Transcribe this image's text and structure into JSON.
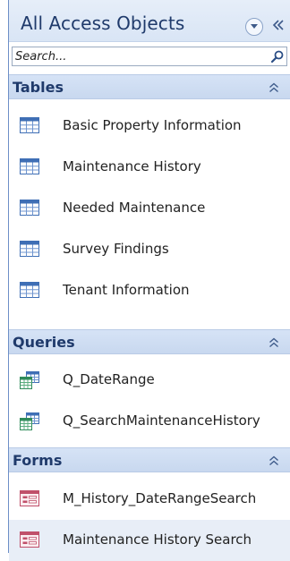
{
  "pane": {
    "title": "All Access Objects",
    "search_placeholder": "Search..."
  },
  "groups": [
    {
      "title": "Tables",
      "items": [
        {
          "label": "Basic Property Information",
          "icon": "table-icon"
        },
        {
          "label": "Maintenance History",
          "icon": "table-icon"
        },
        {
          "label": "Needed Maintenance",
          "icon": "table-icon"
        },
        {
          "label": "Survey Findings",
          "icon": "table-icon"
        },
        {
          "label": "Tenant Information",
          "icon": "table-icon"
        }
      ]
    },
    {
      "title": "Queries",
      "items": [
        {
          "label": "Q_DateRange",
          "icon": "query-icon"
        },
        {
          "label": "Q_SearchMaintenanceHistory",
          "icon": "query-icon"
        }
      ]
    },
    {
      "title": "Forms",
      "items": [
        {
          "label": "M_History_DateRangeSearch",
          "icon": "form-icon"
        },
        {
          "label": "Maintenance History Search",
          "icon": "form-icon",
          "selected": true
        }
      ]
    }
  ],
  "colors": {
    "header_text": "#1f3a6b",
    "group_bg": "#d0ddf2",
    "table_icon": "#3f6fb5",
    "form_icon": "#c0506a"
  }
}
